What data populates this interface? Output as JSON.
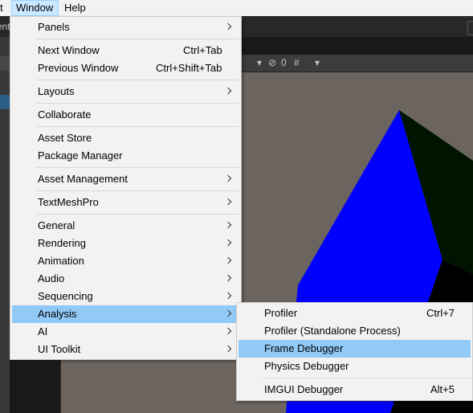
{
  "menubar": {
    "items": [
      {
        "label": "t"
      },
      {
        "label": "Window"
      },
      {
        "label": "Help"
      }
    ]
  },
  "tab_strip": {
    "partial_label": "ent"
  },
  "scene_toolbar": {
    "hidden_count": "0"
  },
  "window_menu": {
    "items": [
      {
        "label": "Panels",
        "submenu": true
      },
      {
        "label": "Next Window",
        "shortcut": "Ctrl+Tab"
      },
      {
        "label": "Previous Window",
        "shortcut": "Ctrl+Shift+Tab"
      },
      {
        "label": "Layouts",
        "submenu": true
      },
      {
        "label": "Collaborate"
      },
      {
        "label": "Asset Store"
      },
      {
        "label": "Package Manager"
      },
      {
        "label": "Asset Management",
        "submenu": true
      },
      {
        "label": "TextMeshPro",
        "submenu": true
      },
      {
        "label": "General",
        "submenu": true
      },
      {
        "label": "Rendering",
        "submenu": true
      },
      {
        "label": "Animation",
        "submenu": true
      },
      {
        "label": "Audio",
        "submenu": true
      },
      {
        "label": "Sequencing",
        "submenu": true
      },
      {
        "label": "Analysis",
        "submenu": true,
        "highlighted": true
      },
      {
        "label": "AI",
        "submenu": true
      },
      {
        "label": "UI Toolkit",
        "submenu": true
      }
    ]
  },
  "analysis_submenu": {
    "items": [
      {
        "label": "Profiler",
        "shortcut": "Ctrl+7"
      },
      {
        "label": "Profiler (Standalone Process)"
      },
      {
        "label": "Frame Debugger",
        "highlighted": true
      },
      {
        "label": "Physics Debugger"
      },
      {
        "label": "IMGUI Debugger",
        "shortcut": "Alt+5"
      }
    ]
  },
  "colors": {
    "menu_bg": "#f2f2f2",
    "menu_highlight": "#91c9f7",
    "scene_bg": "#6c645f",
    "shape_blue": "#0000ff",
    "editor_dark": "#191919"
  }
}
